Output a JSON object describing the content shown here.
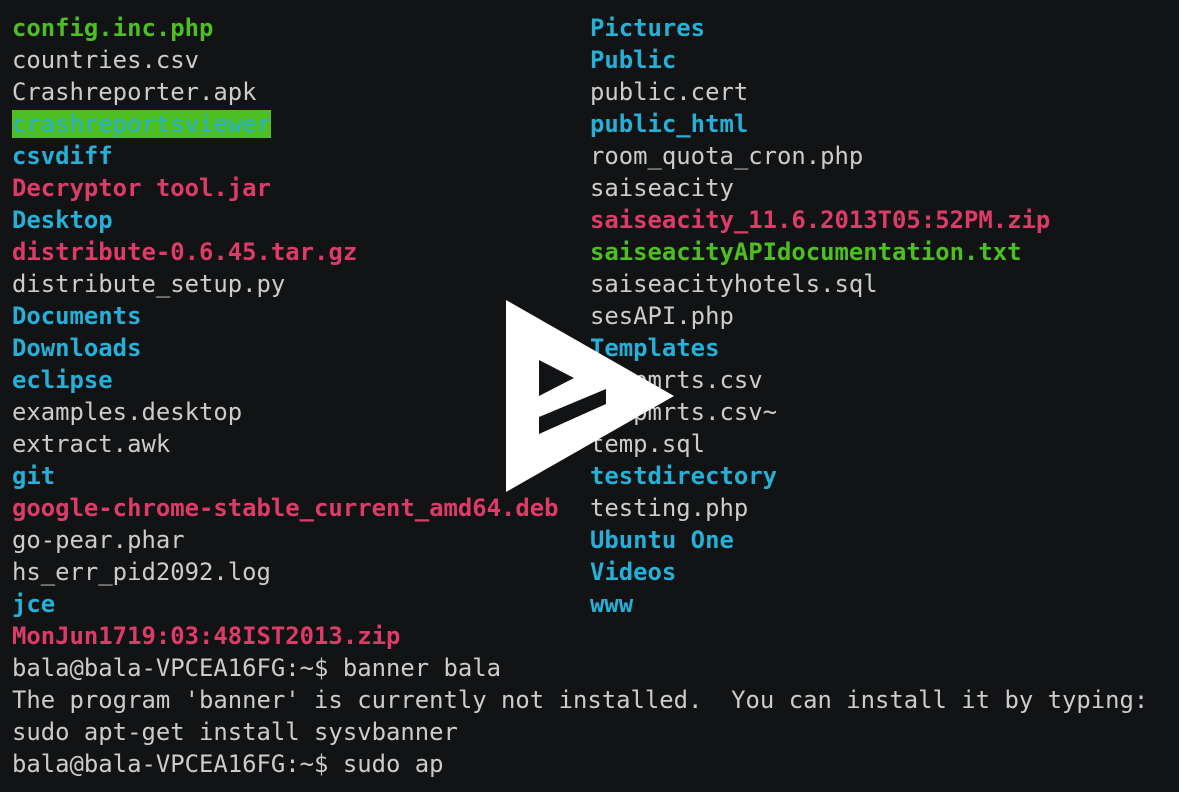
{
  "terminal": {
    "listing_left": [
      {
        "name": "config.inc.php",
        "kind": "exec"
      },
      {
        "name": "countries.csv",
        "kind": "file"
      },
      {
        "name": "Crashreporter.apk",
        "kind": "file"
      },
      {
        "name": "crashreportsviewer",
        "kind": "dir-hl"
      },
      {
        "name": "csvdiff",
        "kind": "dir"
      },
      {
        "name": "Decryptor tool.jar",
        "kind": "archive"
      },
      {
        "name": "Desktop",
        "kind": "dir"
      },
      {
        "name": "distribute-0.6.45.tar.gz",
        "kind": "archive"
      },
      {
        "name": "distribute_setup.py",
        "kind": "file"
      },
      {
        "name": "Documents",
        "kind": "dir"
      },
      {
        "name": "Downloads",
        "kind": "dir"
      },
      {
        "name": "eclipse",
        "kind": "dir"
      },
      {
        "name": "examples.desktop",
        "kind": "file"
      },
      {
        "name": "extract.awk",
        "kind": "file"
      },
      {
        "name": "git",
        "kind": "dir"
      },
      {
        "name": "google-chrome-stable_current_amd64.deb",
        "kind": "archive"
      },
      {
        "name": "go-pear.phar",
        "kind": "file"
      },
      {
        "name": "hs_err_pid2092.log",
        "kind": "file"
      },
      {
        "name": "jce",
        "kind": "dir"
      },
      {
        "name": "MonJun1719:03:48IST2013.zip",
        "kind": "archive"
      }
    ],
    "listing_right": [
      {
        "name": "Pictures",
        "kind": "dir"
      },
      {
        "name": "Public",
        "kind": "dir"
      },
      {
        "name": "public.cert",
        "kind": "file"
      },
      {
        "name": "public_html",
        "kind": "dir"
      },
      {
        "name": "room_quota_cron.php",
        "kind": "file"
      },
      {
        "name": "saiseacity",
        "kind": "file"
      },
      {
        "name": "saiseacity_11.6.2013T05:52PM.zip",
        "kind": "archive"
      },
      {
        "name": "saiseacityAPIdocumentation.txt",
        "kind": "exec"
      },
      {
        "name": "saiseacityhotels.sql",
        "kind": "file"
      },
      {
        "name": "sesAPI.php",
        "kind": "file"
      },
      {
        "name": "Templates",
        "kind": "dir"
      },
      {
        "name": "tempmrts.csv",
        "kind": "file"
      },
      {
        "name": "tempmrts.csv~",
        "kind": "file"
      },
      {
        "name": "temp.sql",
        "kind": "file"
      },
      {
        "name": "testdirectory",
        "kind": "dir"
      },
      {
        "name": "testing.php",
        "kind": "file"
      },
      {
        "name": "Ubuntu One",
        "kind": "dir"
      },
      {
        "name": "Videos",
        "kind": "dir"
      },
      {
        "name": "www",
        "kind": "dir"
      }
    ],
    "console_lines": [
      "bala@bala-VPCEA16FG:~$ banner bala",
      "The program 'banner' is currently not installed.  You can install it by typing:",
      "sudo apt-get install sysvbanner",
      "bala@bala-VPCEA16FG:~$ sudo ap"
    ]
  },
  "overlay": {
    "icon": "asciinema-play-icon",
    "fill_color": "#ffffff",
    "cutout_color": "#121314"
  },
  "colors": {
    "background": "#121314",
    "file": "#cccccc",
    "dir": "#26b0d7",
    "exec": "#4ebf22",
    "archive": "#dd3c69"
  }
}
